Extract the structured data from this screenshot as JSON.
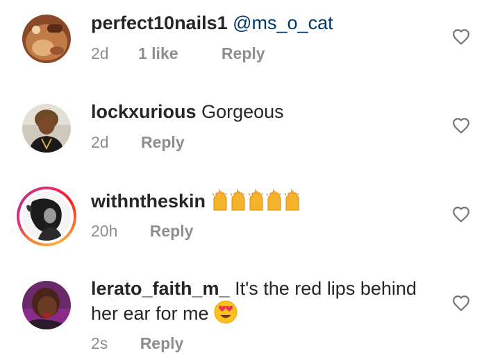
{
  "comments": [
    {
      "username": "perfect10nails1",
      "mention": "@ms_o_cat",
      "text": "",
      "time": "2d",
      "likes": "1 like",
      "reply": "Reply"
    },
    {
      "username": "lockxurious",
      "text": "Gorgeous",
      "time": "2d",
      "reply": "Reply"
    },
    {
      "username": "withntheskin",
      "emoji": "raising-hands-emoji-x5",
      "time": "20h",
      "reply": "Reply"
    },
    {
      "username": "lerato_faith_m_",
      "text_line1": "It's the red lips behind",
      "text_line2": "her ear for me",
      "emoji": "smiling-face-with-heart-eyes-emoji",
      "time": "2s",
      "reply": "Reply"
    }
  ],
  "colors": {
    "text": "#262626",
    "secondary": "#8e8e8e",
    "mention": "#00376b",
    "background": "#ffffff"
  },
  "icons": [
    "heart-outline-icon"
  ]
}
